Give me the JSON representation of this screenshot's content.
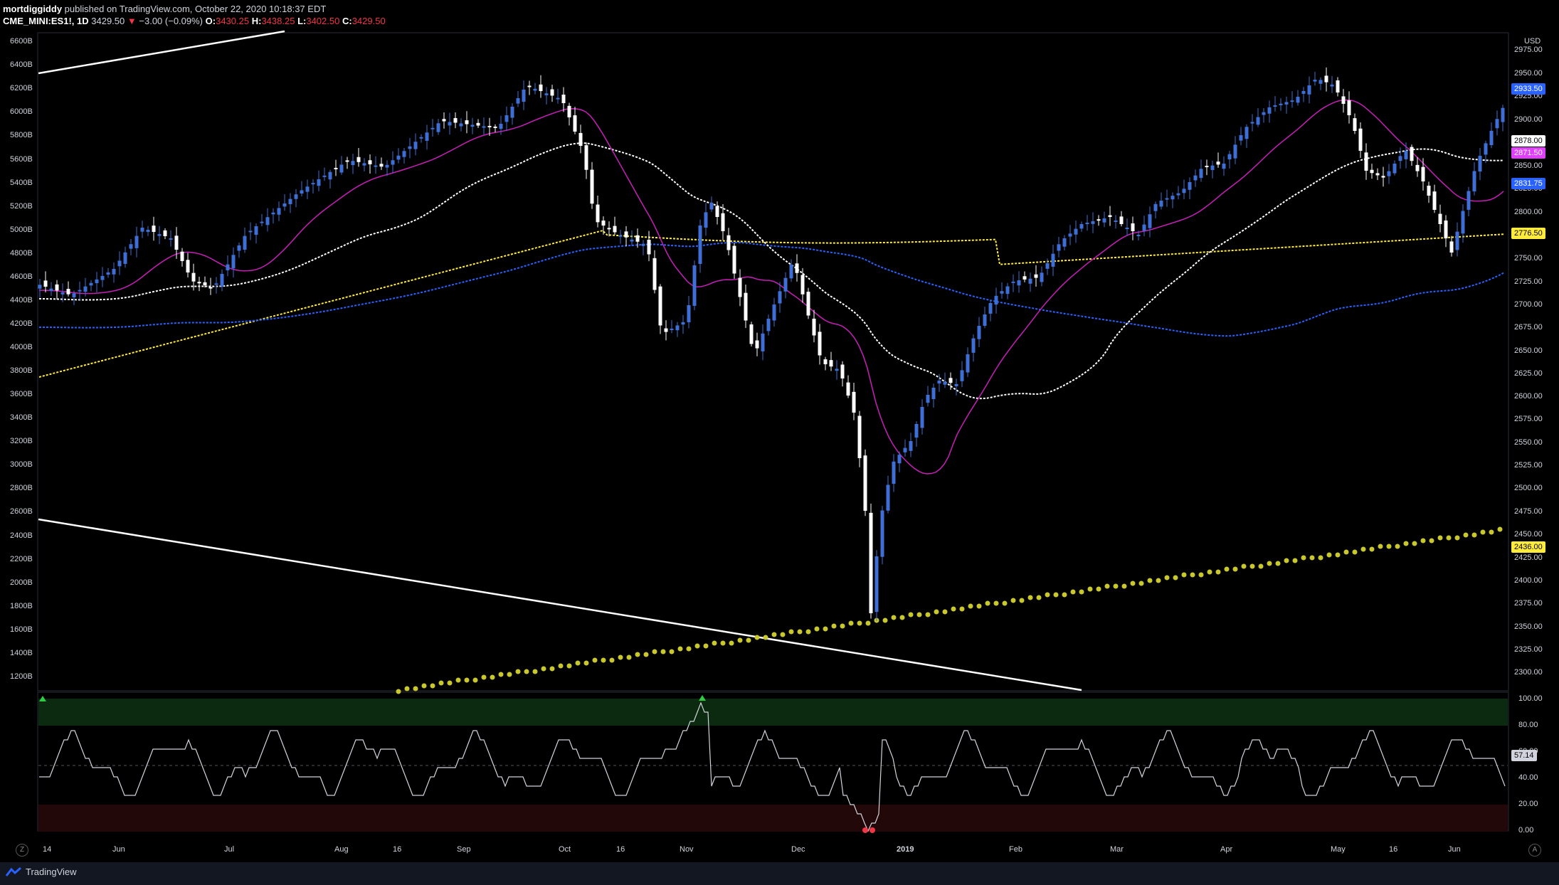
{
  "header": {
    "author": "mortdiggiddy",
    "published": "published on TradingView.com, October 22, 2020 10:18:37 EDT",
    "symbol": "CME_MINI:ES1!, 1D",
    "last": "3429.50",
    "change": "−3.00 (−0.09%)",
    "o_label": "O:",
    "o": "3430.25",
    "h_label": "H:",
    "h": "3438.25",
    "l_label": "L:",
    "l": "3402.50",
    "c_label": "C:",
    "c": "3429.50"
  },
  "axis": {
    "currency": "USD",
    "left_ticks": [
      "6600B",
      "6400B",
      "6200B",
      "6000B",
      "5800B",
      "5600B",
      "5400B",
      "5200B",
      "5000B",
      "4800B",
      "4600B",
      "4400B",
      "4200B",
      "4000B",
      "3800B",
      "3600B",
      "3400B",
      "3200B",
      "3000B",
      "2800B",
      "2600B",
      "2400B",
      "2200B",
      "2000B",
      "1800B",
      "1600B",
      "1400B",
      "1200B"
    ],
    "right_ticks": [
      "2975.00",
      "2950.00",
      "2925.00",
      "2900.00",
      "2850.00",
      "2825.00",
      "2800.00",
      "2750.00",
      "2725.00",
      "2700.00",
      "2675.00",
      "2650.00",
      "2625.00",
      "2600.00",
      "2575.00",
      "2550.00",
      "2525.00",
      "2500.00",
      "2475.00",
      "2450.00",
      "2425.00",
      "2400.00",
      "2375.00",
      "2350.00",
      "2325.00",
      "2300.00"
    ],
    "osc_ticks": [
      "100.00",
      "80.00",
      "60.00",
      "40.00",
      "20.00",
      "0.00"
    ],
    "time_labels": [
      "14",
      "Jun",
      "Jul",
      "Aug",
      "16",
      "Sep",
      "Oct",
      "16",
      "Nov",
      "Dec",
      "2019",
      "Feb",
      "Mar",
      "Apr",
      "May",
      "16",
      "Jun"
    ]
  },
  "price_tags": [
    {
      "text": "2933.50",
      "bg": "#2962ff",
      "fg": "#ffffff"
    },
    {
      "text": "2878.00",
      "bg": "#ffffff",
      "fg": "#000000"
    },
    {
      "text": "2871.50",
      "bg": "#e040fb",
      "fg": "#ffffff"
    },
    {
      "text": "2831.75",
      "bg": "#2962ff",
      "fg": "#ffffff"
    },
    {
      "text": "2776.50",
      "bg": "#ffeb3b",
      "fg": "#000000"
    },
    {
      "text": "2436.00",
      "bg": "#ffeb3b",
      "fg": "#000000"
    },
    {
      "text": "57.14",
      "bg": "#d1d4dc",
      "fg": "#000000"
    }
  ],
  "colors": {
    "bull": "#3d6fd6",
    "bear": "#ffffff",
    "ema_fast": "#c71fb8",
    "sma_mid": "#ffffff",
    "ma_blue": "#2962ff",
    "ma_yellow": "#ffeb3b",
    "dots": "#c8c82a"
  },
  "footer": {
    "brand": "TradingView",
    "left_button": "Z",
    "right_button": "A"
  }
}
